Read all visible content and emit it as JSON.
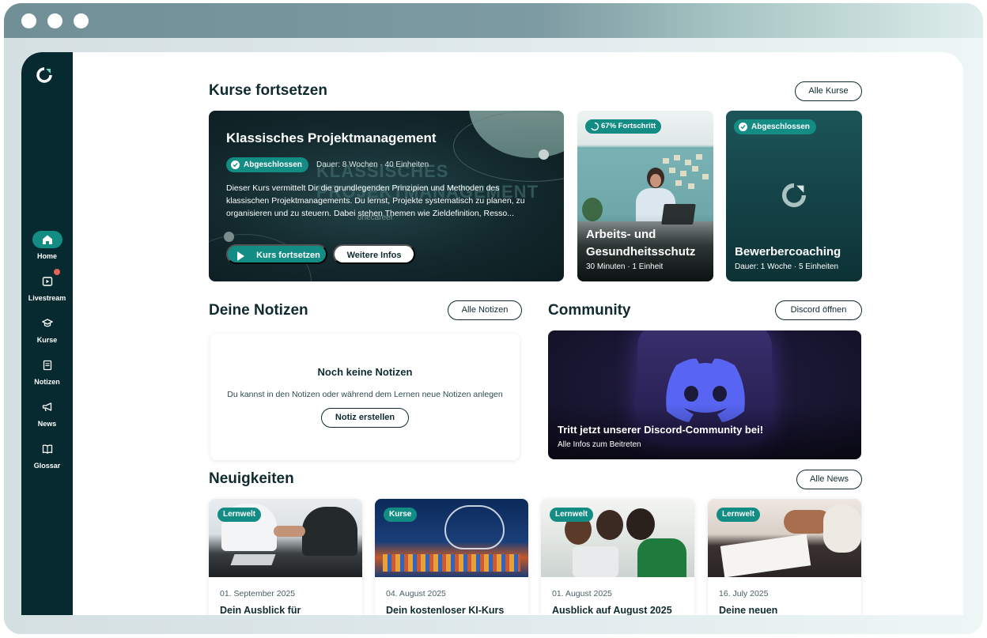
{
  "sidebar": {
    "items": [
      {
        "label": "Home",
        "icon": "home-icon",
        "active": true
      },
      {
        "label": "Livestream",
        "icon": "play-icon",
        "badge": true
      },
      {
        "label": "Kurse",
        "icon": "graduation-cap-icon"
      },
      {
        "label": "Notizen",
        "icon": "notes-icon"
      },
      {
        "label": "News",
        "icon": "megaphone-icon"
      },
      {
        "label": "Glossar",
        "icon": "book-icon"
      }
    ]
  },
  "courses": {
    "title": "Kurse fortsetzen",
    "all_label": "Alle Kurse",
    "hero": {
      "title": "Klassisches Projektmanagement",
      "status": "Abgeschlossen",
      "meta": "Dauer: 8 Wochen · 40 Einheiten",
      "description": "Dieser Kurs vermittelt Dir die grundlegenden Prinzipien und Methoden des klassischen Projektmanagements. Du lernst, Projekte systematisch zu planen, zu organisieren und zu steuern. Dabei stehen Themen wie Zieldefinition, Resso...",
      "watermark": "KLASSISCHES PROJEKTMANAGEMENT",
      "watermark_brand": "onecareer",
      "primary_label": "Kurs fortsetzen",
      "secondary_label": "Weitere Infos"
    },
    "cards": [
      {
        "badge": "67% Fortschritt",
        "progress": 0.67,
        "title_line1": "Arbeits- und",
        "title_line2": "Gesundheitsschutz",
        "meta": "30 Minuten · 1 Einheit"
      },
      {
        "badge": "Abgeschlossen",
        "title": "Bewerbercoaching",
        "meta": "Dauer: 1 Woche · 5 Einheiten"
      }
    ]
  },
  "notes": {
    "title": "Deine Notizen",
    "all_label": "Alle Notizen",
    "empty_title": "Noch keine Notizen",
    "empty_text": "Du kannst in den Notizen oder während dem Lernen neue Notizen anlegen",
    "create_label": "Notiz erstellen"
  },
  "community": {
    "title": "Community",
    "button_label": "Discord öffnen",
    "card_title": "Tritt jetzt unserer Discord-Community bei!",
    "card_sub": "Alle Infos zum Beitreten"
  },
  "news": {
    "title": "Neuigkeiten",
    "all_label": "Alle News",
    "items": [
      {
        "tag": "Lernwelt",
        "date": "01. September 2025",
        "title": "Dein Ausblick für"
      },
      {
        "tag": "Kurse",
        "date": "04. August 2025",
        "title": "Dein kostenloser KI-Kurs"
      },
      {
        "tag": "Lernwelt",
        "date": "01. August 2025",
        "title": "Ausblick auf August 2025"
      },
      {
        "tag": "Lernwelt",
        "date": "16. July 2025",
        "title": "Deine neuen"
      }
    ]
  },
  "colors": {
    "sidebar": "#062a2f",
    "accent": "#138c84",
    "text": "#0f2b30",
    "notification": "#e4645a"
  }
}
